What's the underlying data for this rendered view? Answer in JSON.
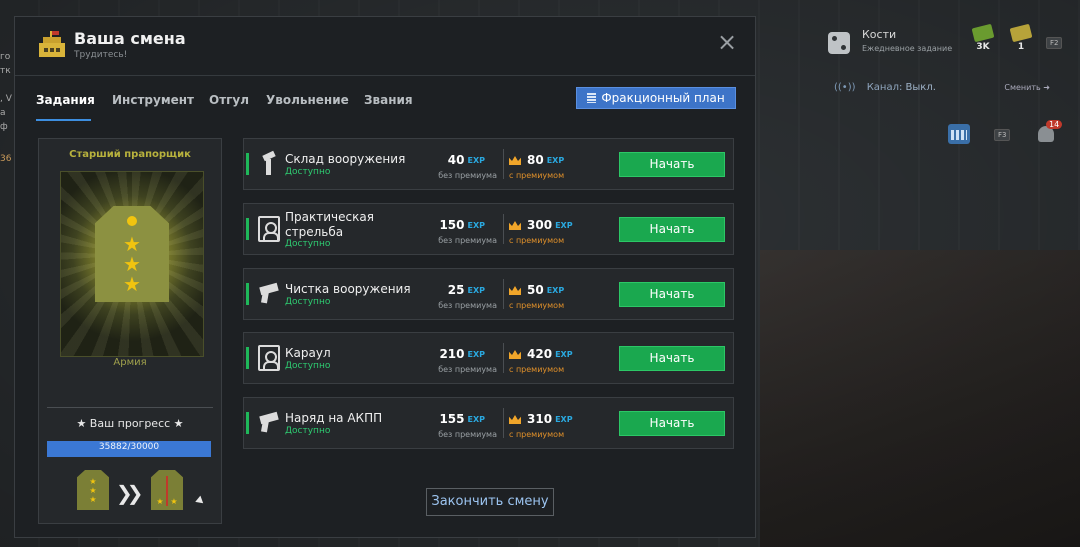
{
  "hud": {
    "dice_title": "Кости",
    "dice_subtitle": "Ежедневное задание",
    "money_green": "3K",
    "money_yellow": "1",
    "key_hint": "F2",
    "channel_label": "Канал:",
    "channel_value": "Выкл.",
    "channel_switch": "Сменить",
    "key_f3": "F3",
    "notifications": "14",
    "left_edge": [
      "го",
      "тк",
      ", V",
      "а ф"
    ],
    "left_number": "36"
  },
  "window": {
    "title": "Ваша смена",
    "subtitle": "Трудитесь!",
    "close": "×",
    "tabs": [
      "Задания",
      "Инструмент",
      "Отгул",
      "Увольнение",
      "Звания"
    ],
    "active_tab": 0,
    "plan_button": "Фракционный план",
    "finish_button": "Закончить смену"
  },
  "rank": {
    "title": "Старший прапорщик",
    "faction": "Армия",
    "progress_title": "★ Ваш прогресс ★",
    "progress_text": "35882/30000",
    "progress_fraction": 1.0,
    "next_arrows": "❯❯"
  },
  "tasks": [
    {
      "name": "Склад вооружения",
      "status": "Доступно",
      "base": "40",
      "premium": "80",
      "icon": "rack-icon"
    },
    {
      "name": "Практическая стрельба",
      "status": "Доступно",
      "base": "150",
      "premium": "300",
      "icon": "target-icon"
    },
    {
      "name": "Чистка вооружения",
      "status": "Доступно",
      "base": "25",
      "premium": "50",
      "icon": "gun-icon"
    },
    {
      "name": "Караул",
      "status": "Доступно",
      "base": "210",
      "premium": "420",
      "icon": "target-icon"
    },
    {
      "name": "Наряд на АКПП",
      "status": "Доступно",
      "base": "155",
      "premium": "310",
      "icon": "gun-icon"
    }
  ],
  "labels": {
    "exp": "EXP",
    "no_premium": "без премиума",
    "with_premium": "с премиумом",
    "start": "Начать"
  },
  "colors": {
    "accent_blue": "#3d8ee0",
    "start_green": "#1aa84f",
    "status_green": "#2ecc71",
    "premium_orange": "#e0902a",
    "exp_blue": "#2aa9e0",
    "rank_gold": "#b8b23d"
  }
}
